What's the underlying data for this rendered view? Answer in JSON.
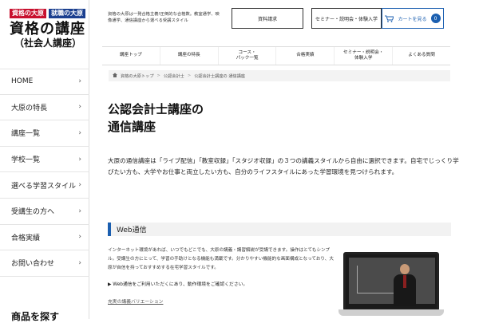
{
  "logo": {
    "badge1": "資格の大原",
    "badge2": "就職の大原",
    "main": "資格の講座",
    "sub": "（社会人講座）"
  },
  "sidebar": {
    "items": [
      {
        "label": "HOME"
      },
      {
        "label": "大原の特長"
      },
      {
        "label": "講座一覧"
      },
      {
        "label": "学校一覧"
      },
      {
        "label": "選べる学習スタイル"
      },
      {
        "label": "受講生の方へ"
      },
      {
        "label": "合格実績"
      },
      {
        "label": "お問い合わせ"
      }
    ],
    "footer_heading": "商品を探す"
  },
  "header": {
    "description": "資格の大原は一発合格主義!圧倒的な合格数。教室通学、映像通学、通信講座から選べる受講スタイル",
    "request_button": "資料請求",
    "seminar_button": "セミナー・説明会・体験入学",
    "cart_button": "カートを見る",
    "cart_count": "0"
  },
  "topnav": {
    "items": [
      {
        "label": "講座トップ"
      },
      {
        "label": "講座の特長"
      },
      {
        "label": "コース・\nパック一覧"
      },
      {
        "label": "合格実績"
      },
      {
        "label": "セミナー・説明会・\n体験入学"
      },
      {
        "label": "よくある質問"
      }
    ]
  },
  "breadcrumb": {
    "home": "資格の大原トップ",
    "level1": "公認会計士",
    "current": "公認会計士講座の 通信講座"
  },
  "page": {
    "title_line1": "公認会計士講座の",
    "title_line2": "通信講座",
    "intro": "大原の通信講座は「ライブ配信」「教室収録」「スタジオ収録」の３つの講義スタイルから自由に選択できます。自宅でじっくり学びたい方も、大学やお仕事と両立したい方も、自分のライフスタイルにあった学習環境を見つけられます。"
  },
  "web_section": {
    "heading": "Web通信",
    "text": "インターネット環境があれば、いつでもどこでも、大原の講義・講習解説が受講できます。操作はとてもシンプル。受講生の方にとって、学習の手助けとなる機能も満載です。分かりやすい機能的な画面構成となっており、大原が自信を持っておすすめする在宅学習スタイルです。",
    "env_link": "▶ Web通信をご利用いただくにあり、動作環境をご確認ください。",
    "bottom_link": "充実の講義バリエーション"
  }
}
